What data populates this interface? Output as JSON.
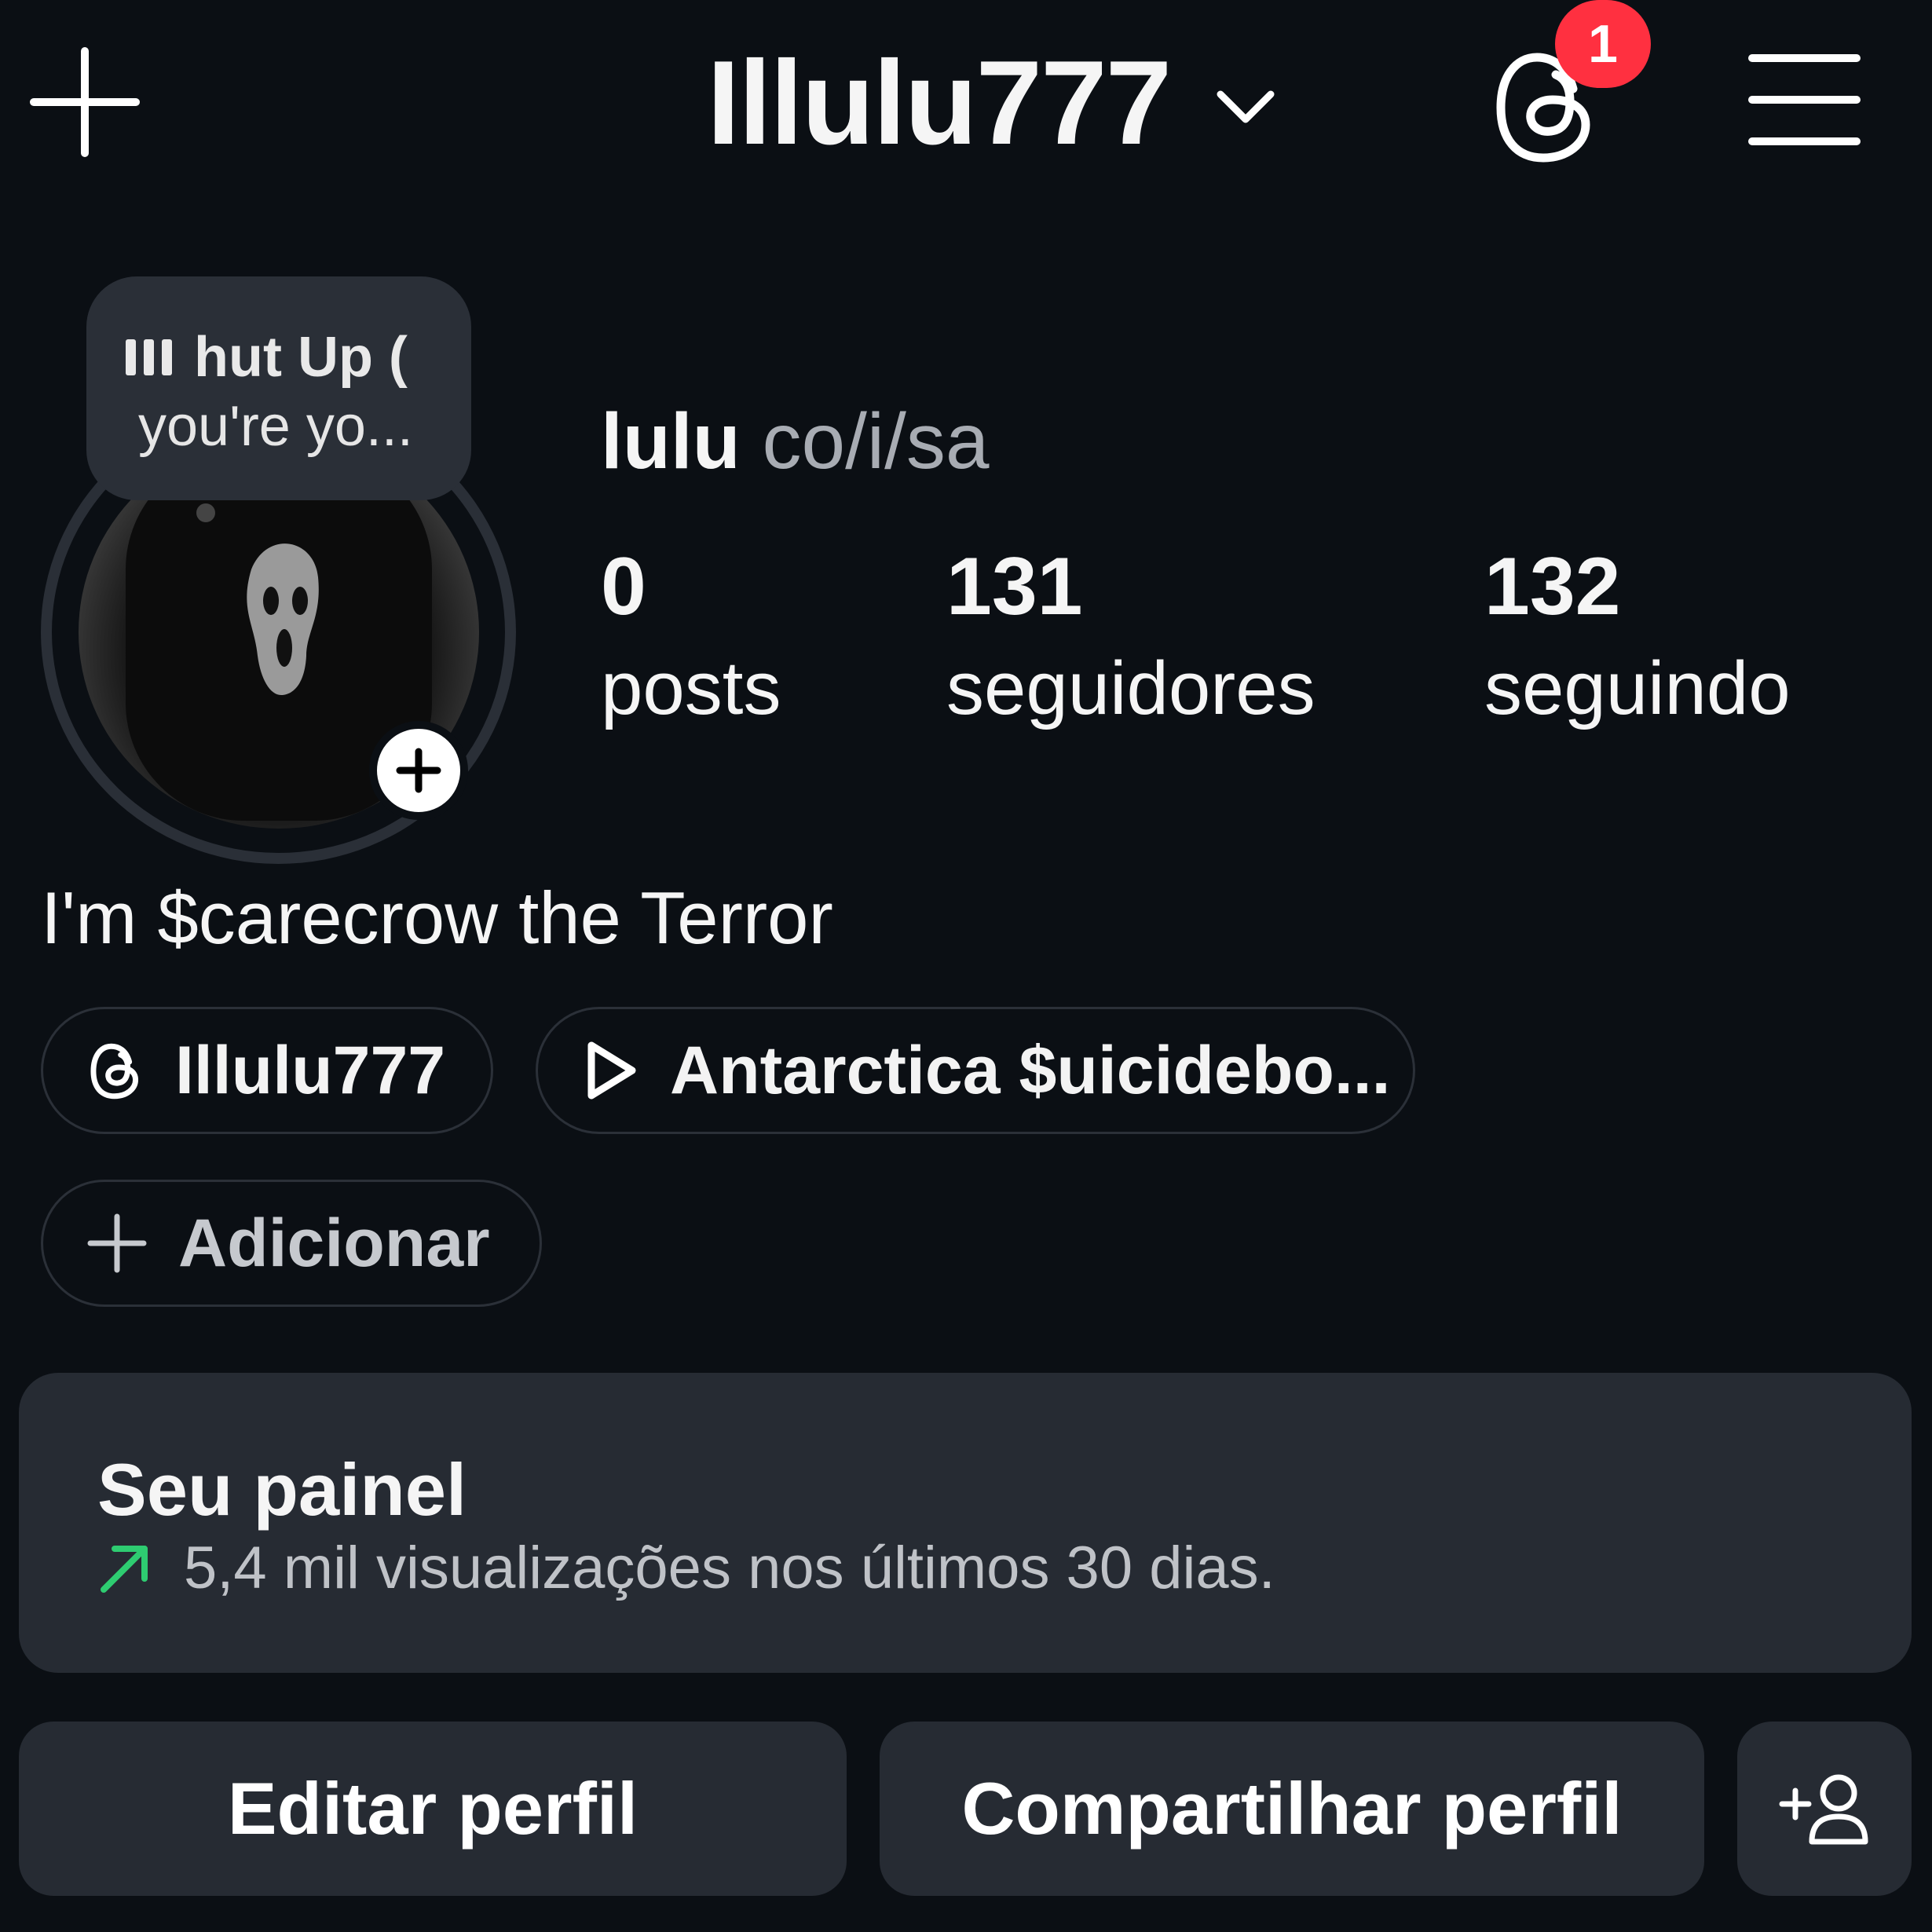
{
  "header": {
    "username": "Illulu777",
    "notification_count": "1"
  },
  "note": {
    "line1": "hut Up (",
    "line2": "you're yo..."
  },
  "profile": {
    "name": "lulu",
    "pronouns": "co/i/sa",
    "bio": "I'm $carecrow the Terror"
  },
  "stats": [
    {
      "value": "0",
      "label": "posts"
    },
    {
      "value": "131",
      "label": "seguidores"
    },
    {
      "value": "132",
      "label": "seguindo"
    }
  ],
  "chips": {
    "threads": "Illulu777",
    "music": "Antarctica $uicidebo...",
    "add": "Adicionar"
  },
  "dashboard": {
    "title": "Seu painel",
    "subtitle": "5,4 mil visualizações nos últimos 30 dias."
  },
  "actions": {
    "edit": "Editar perfil",
    "share": "Compartilhar perfil"
  },
  "colors": {
    "background": "#0b0f14",
    "surface": "#262b33",
    "badge": "#ff3040",
    "trend": "#2ecc71"
  }
}
